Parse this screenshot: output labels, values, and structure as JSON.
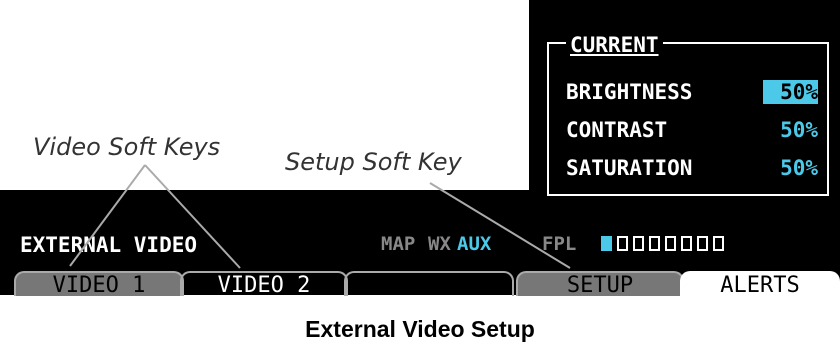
{
  "settings": {
    "legend": "CURRENT",
    "rows": [
      {
        "label": "BRIGHTNESS",
        "value": "50%"
      },
      {
        "label": "CONTRAST",
        "value": "50%"
      },
      {
        "label": "SATURATION",
        "value": "50%"
      }
    ]
  },
  "page_title": "EXTERNAL VIDEO",
  "page_groups": [
    {
      "label": "MAP"
    },
    {
      "label": "WX"
    },
    {
      "label": "AUX"
    },
    {
      "label": "FPL"
    }
  ],
  "active_group": "AUX",
  "page_index": {
    "total": 8,
    "current": 1
  },
  "softkeys": {
    "video1": "VIDEO 1",
    "video2": "VIDEO 2",
    "setup": "SETUP",
    "alerts": "ALERTS"
  },
  "callouts": {
    "video_keys": "Video Soft Keys",
    "setup_key": "Setup Soft Key"
  },
  "caption": "External Video Setup",
  "colors": {
    "accent": "#4cc8e8",
    "background": "#000000"
  }
}
